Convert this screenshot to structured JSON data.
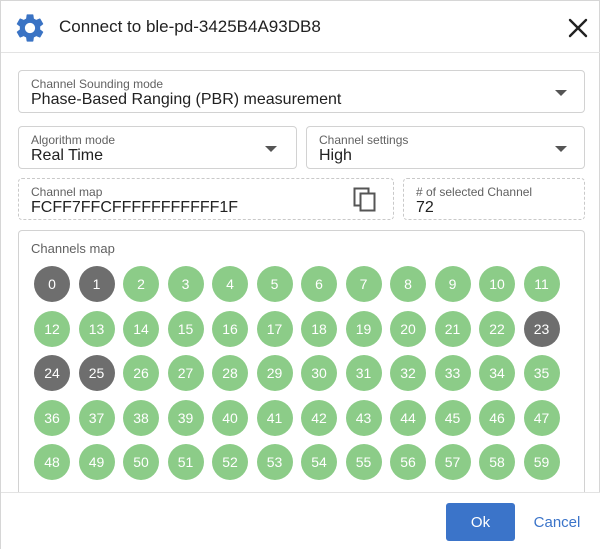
{
  "dialog": {
    "title": "Connect to ble-pd-3425B4A93DB8"
  },
  "fields": {
    "sounding_mode": {
      "label": "Channel Sounding mode",
      "value": "Phase-Based Ranging (PBR) measurement"
    },
    "algorithm_mode": {
      "label": "Algorithm mode",
      "value": "Real Time"
    },
    "channel_settings": {
      "label": "Channel settings",
      "value": "High"
    },
    "channel_map": {
      "label": "Channel map",
      "value": "FCFF7FFCFFFFFFFFFFF1F"
    },
    "selected_count": {
      "label": "# of selected Channel",
      "value": "72"
    }
  },
  "channels_map": {
    "label": "Channels map",
    "channels": [
      {
        "n": "0",
        "on": false
      },
      {
        "n": "1",
        "on": false
      },
      {
        "n": "2",
        "on": true
      },
      {
        "n": "3",
        "on": true
      },
      {
        "n": "4",
        "on": true
      },
      {
        "n": "5",
        "on": true
      },
      {
        "n": "6",
        "on": true
      },
      {
        "n": "7",
        "on": true
      },
      {
        "n": "8",
        "on": true
      },
      {
        "n": "9",
        "on": true
      },
      {
        "n": "10",
        "on": true
      },
      {
        "n": "11",
        "on": true
      },
      {
        "n": "12",
        "on": true
      },
      {
        "n": "13",
        "on": true
      },
      {
        "n": "14",
        "on": true
      },
      {
        "n": "15",
        "on": true
      },
      {
        "n": "16",
        "on": true
      },
      {
        "n": "17",
        "on": true
      },
      {
        "n": "18",
        "on": true
      },
      {
        "n": "19",
        "on": true
      },
      {
        "n": "20",
        "on": true
      },
      {
        "n": "21",
        "on": true
      },
      {
        "n": "22",
        "on": true
      },
      {
        "n": "23",
        "on": false
      },
      {
        "n": "24",
        "on": false
      },
      {
        "n": "25",
        "on": false
      },
      {
        "n": "26",
        "on": true
      },
      {
        "n": "27",
        "on": true
      },
      {
        "n": "28",
        "on": true
      },
      {
        "n": "29",
        "on": true
      },
      {
        "n": "30",
        "on": true
      },
      {
        "n": "31",
        "on": true
      },
      {
        "n": "32",
        "on": true
      },
      {
        "n": "33",
        "on": true
      },
      {
        "n": "34",
        "on": true
      },
      {
        "n": "35",
        "on": true
      },
      {
        "n": "36",
        "on": true
      },
      {
        "n": "37",
        "on": true
      },
      {
        "n": "38",
        "on": true
      },
      {
        "n": "39",
        "on": true
      },
      {
        "n": "40",
        "on": true
      },
      {
        "n": "41",
        "on": true
      },
      {
        "n": "42",
        "on": true
      },
      {
        "n": "43",
        "on": true
      },
      {
        "n": "44",
        "on": true
      },
      {
        "n": "45",
        "on": true
      },
      {
        "n": "46",
        "on": true
      },
      {
        "n": "47",
        "on": true
      },
      {
        "n": "48",
        "on": true
      },
      {
        "n": "49",
        "on": true
      },
      {
        "n": "50",
        "on": true
      },
      {
        "n": "51",
        "on": true
      },
      {
        "n": "52",
        "on": true
      },
      {
        "n": "53",
        "on": true
      },
      {
        "n": "54",
        "on": true
      },
      {
        "n": "55",
        "on": true
      },
      {
        "n": "56",
        "on": true
      },
      {
        "n": "57",
        "on": true
      },
      {
        "n": "58",
        "on": true
      },
      {
        "n": "59",
        "on": true
      }
    ]
  },
  "buttons": {
    "ok": "Ok",
    "cancel": "Cancel"
  },
  "colors": {
    "accent": "#3b74c9",
    "channel_on": "#8ccc88",
    "channel_off": "#6e6e6e",
    "gear": "#3a73c4"
  },
  "icons": {
    "app": "gear-icon",
    "close": "close-icon",
    "dropdown": "caret-down-icon",
    "copy": "copy-icon"
  }
}
